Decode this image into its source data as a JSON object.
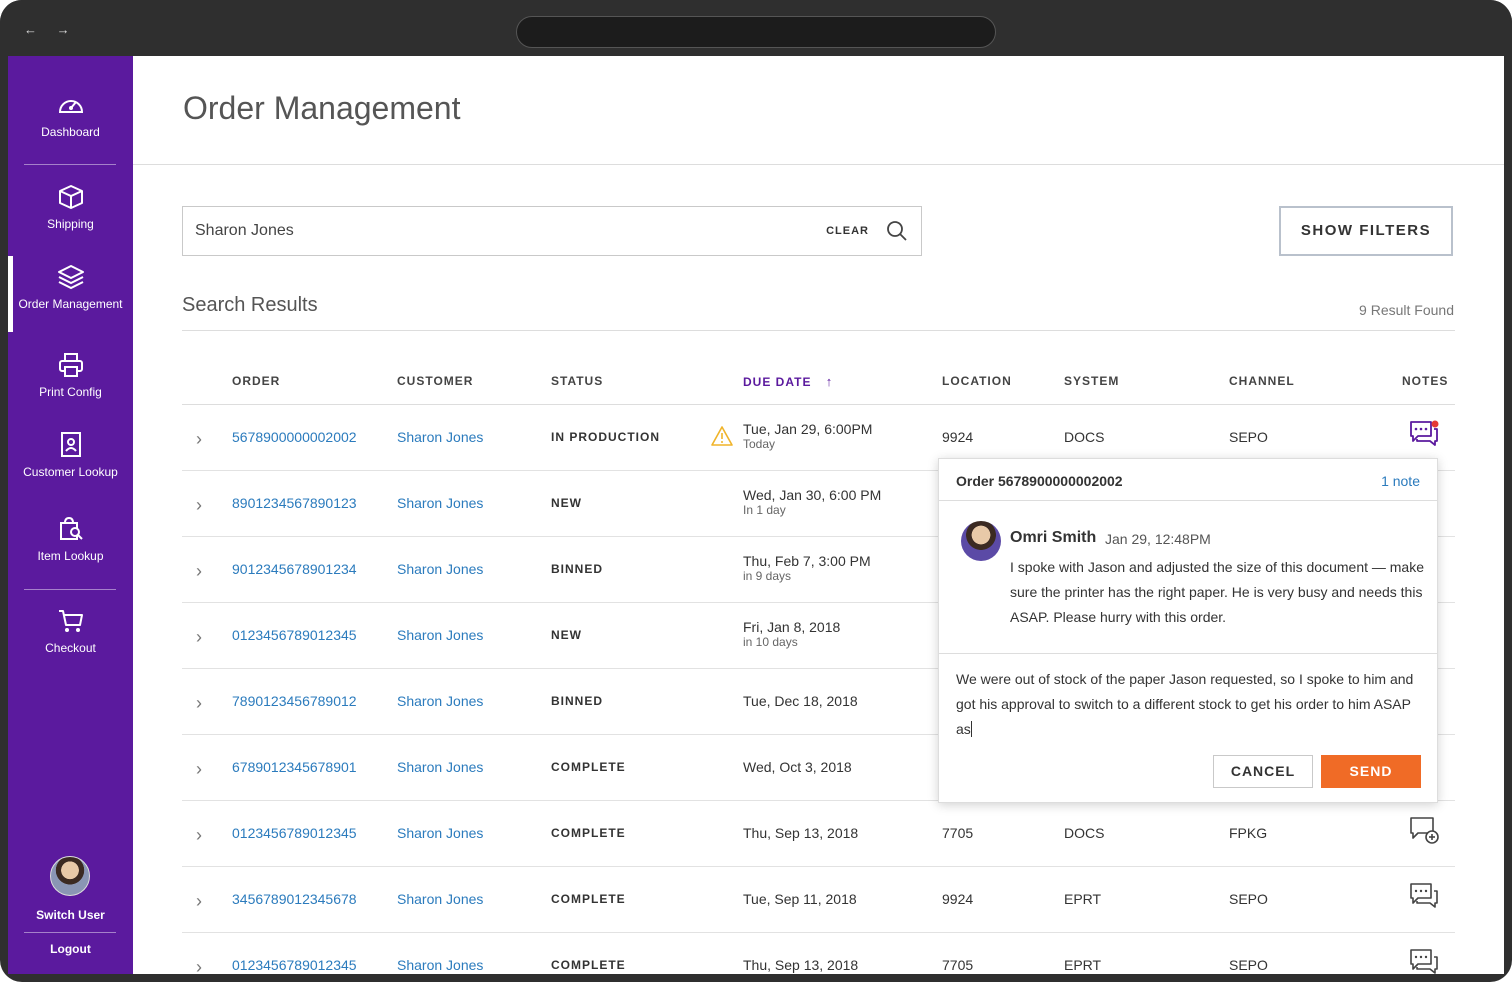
{
  "browser": {
    "nav_arrows": "← →"
  },
  "sidebar": {
    "items": [
      {
        "label": "Dashboard"
      },
      {
        "label": "Shipping"
      },
      {
        "label": "Order Management"
      },
      {
        "label": "Print Config"
      },
      {
        "label": "Customer Lookup"
      },
      {
        "label": "Item Lookup"
      },
      {
        "label": "Checkout"
      }
    ],
    "switch_user": "Switch User",
    "logout": "Logout",
    "accent": "#5b1a9e"
  },
  "page": {
    "title": "Order Management"
  },
  "search": {
    "value": "Sharon Jones",
    "clear_label": "CLEAR"
  },
  "filters_button": "SHOW FILTERS",
  "results": {
    "title": "Search Results",
    "count": "9 Result Found"
  },
  "table": {
    "headers": {
      "order": "ORDER",
      "customer": "CUSTOMER",
      "status": "STATUS",
      "due_date": "DUE DATE",
      "sort_arrow": "↑",
      "location": "LOCATION",
      "system": "SYSTEM",
      "channel": "CHANNEL",
      "notes": "NOTES"
    },
    "rows": [
      {
        "order": "5678900000002002",
        "customer": "Sharon Jones",
        "status": "IN PRODUCTION",
        "due": "Tue, Jan 29, 6:00PM",
        "due_sub": "Today",
        "location": "9924",
        "system": "DOCS",
        "channel": "SEPO",
        "warning": true,
        "notes_icon": "chat-unread-icon"
      },
      {
        "order": "8901234567890123",
        "customer": "Sharon Jones",
        "status": "NEW",
        "due": "Wed, Jan 30, 6:00 PM",
        "due_sub": "In 1 day"
      },
      {
        "order": "9012345678901234",
        "customer": "Sharon Jones",
        "status": "BINNED",
        "due": "Thu, Feb 7, 3:00 PM",
        "due_sub": "in 9 days"
      },
      {
        "order": "0123456789012345",
        "customer": "Sharon Jones",
        "status": "NEW",
        "due": "Fri, Jan 8, 2018",
        "due_sub": "in 10 days"
      },
      {
        "order": "7890123456789012",
        "customer": "Sharon Jones",
        "status": "BINNED",
        "due": "Tue, Dec 18, 2018"
      },
      {
        "order": "6789012345678901",
        "customer": "Sharon Jones",
        "status": "COMPLETE",
        "due": "Wed, Oct 3, 2018"
      },
      {
        "order": "0123456789012345",
        "customer": "Sharon Jones",
        "status": "COMPLETE",
        "due": "Thu, Sep 13, 2018",
        "location": "7705",
        "system": "DOCS",
        "channel": "FPKG",
        "notes_icon": "chat-add-icon"
      },
      {
        "order": "3456789012345678",
        "customer": "Sharon Jones",
        "status": "COMPLETE",
        "due": "Tue, Sep 11, 2018",
        "location": "9924",
        "system": "EPRT",
        "channel": "SEPO",
        "notes_icon": "chat-icon"
      },
      {
        "order": "0123456789012345",
        "customer": "Sharon Jones",
        "status": "COMPLETE",
        "due": "Thu, Sep 13, 2018",
        "location": "7705",
        "system": "EPRT",
        "channel": "SEPO",
        "notes_icon": "chat-icon"
      }
    ]
  },
  "notes_popover": {
    "title": "Order 5678900000002002",
    "count": "1 note",
    "author": "Omri Smith",
    "time": "Jan 29, 12:48PM",
    "text": "I spoke with Jason and adjusted the size of this document — make sure the printer has the right paper. He is very busy and needs this ASAP. Please hurry with this order.",
    "reply": "We were out of stock of the paper Jason requested, so I spoke to him and got his approval to switch to a different stock to get his order to him ASAP as",
    "cancel": "CANCEL",
    "send": "SEND",
    "send_color": "#f06b26"
  }
}
